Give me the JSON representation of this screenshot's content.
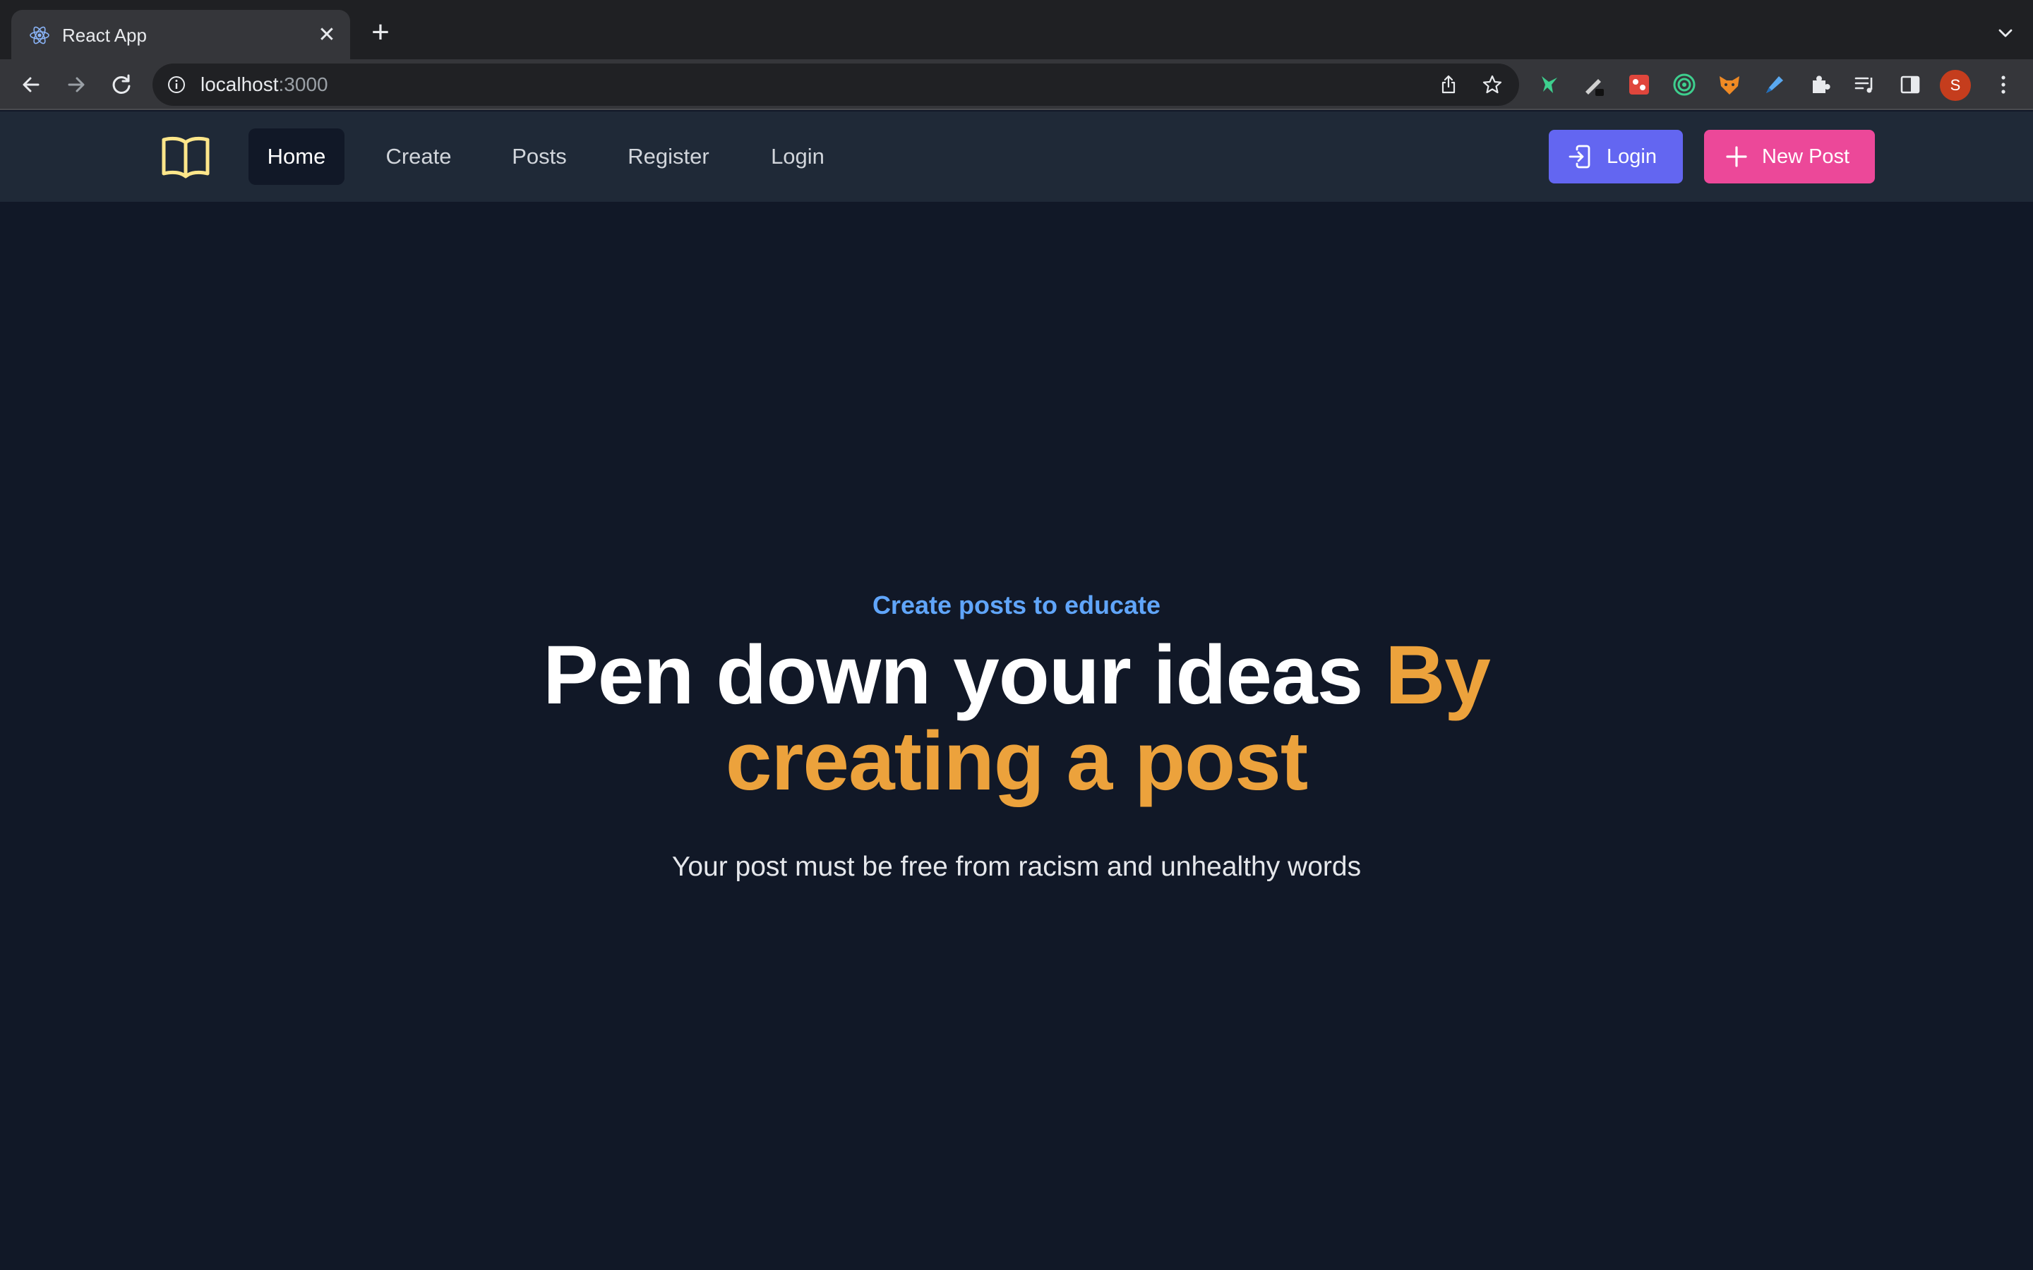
{
  "browser": {
    "tab_title": "React App",
    "tab_favicon": "react-icon",
    "url_host": "localhost",
    "url_port": ":3000",
    "extensions": [
      "hummingbird-icon",
      "pen-icon",
      "puzzle-game-icon",
      "target-icon",
      "fox-icon",
      "highlighter-icon",
      "puzzle-icon",
      "playlist-icon",
      "sidebar-icon"
    ],
    "profile_initial": "S"
  },
  "header": {
    "logo": "book-icon",
    "nav": [
      {
        "label": "Home",
        "active": true
      },
      {
        "label": "Create",
        "active": false
      },
      {
        "label": "Posts",
        "active": false
      },
      {
        "label": "Register",
        "active": false
      },
      {
        "label": "Login",
        "active": false
      }
    ],
    "login_button": "Login",
    "new_post_button": "New Post"
  },
  "hero": {
    "eyebrow": "Create posts to educate",
    "headline_main": "Pen down your ideas",
    "headline_accent": "By creating a post",
    "subtext": "Your post must be free from racism and unhealthy words"
  },
  "colors": {
    "page_bg": "#111827",
    "nav_bg": "#1f2937",
    "eyebrow": "#60a5fa",
    "accent": "#eca23c",
    "login_btn": "#6366f1",
    "new_post_btn": "#ec4899",
    "logo": "#fde68a"
  }
}
